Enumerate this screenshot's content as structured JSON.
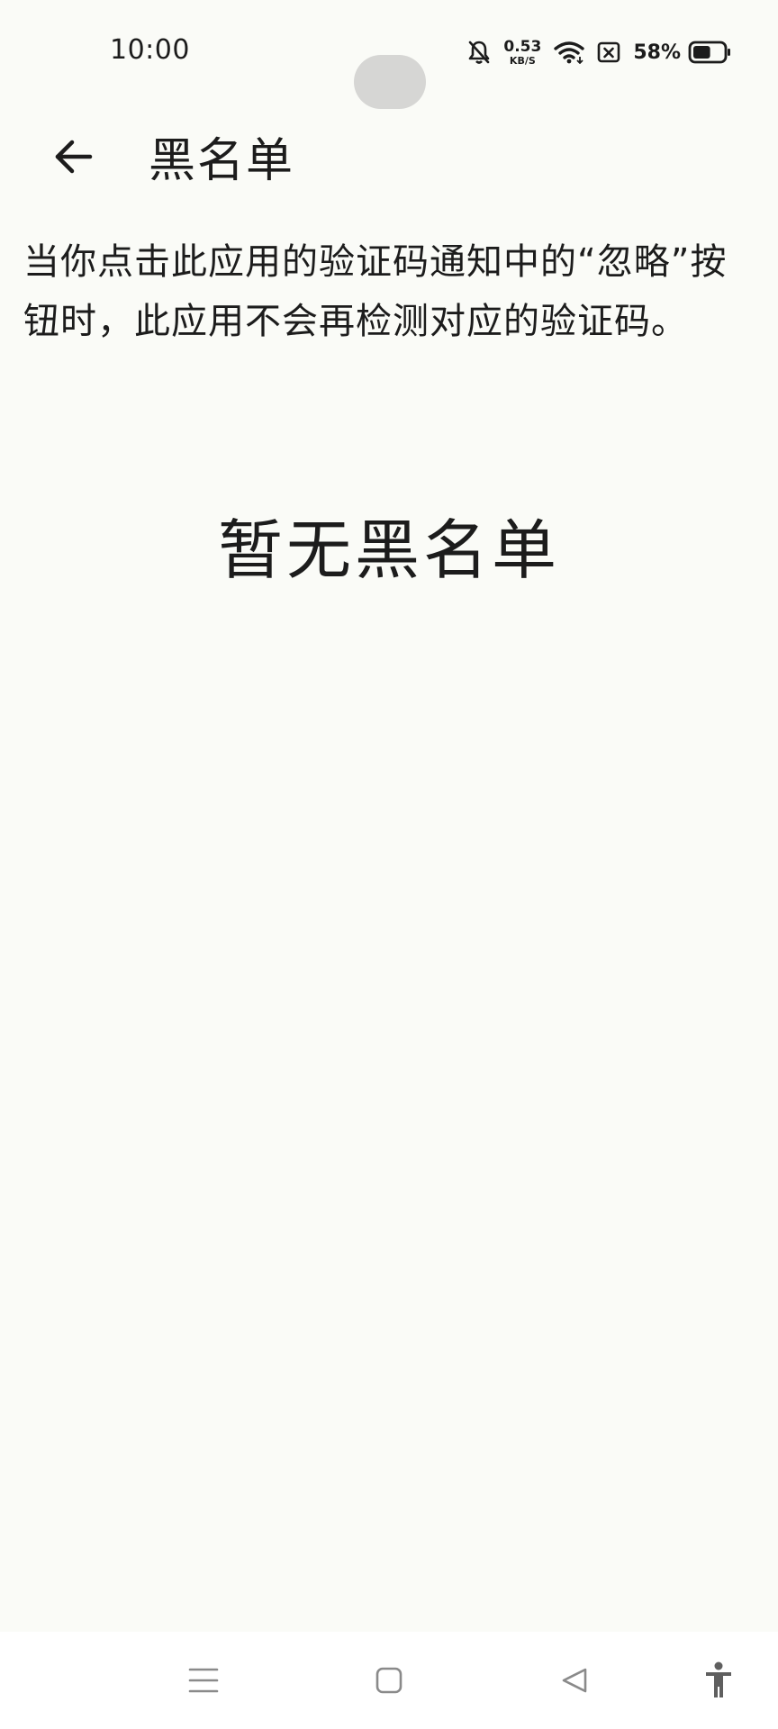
{
  "status_bar": {
    "time": "10:00",
    "net_speed_value": "0.53",
    "net_speed_unit": "KB/S",
    "battery_percent": "58%",
    "battery_level": 0.58,
    "icons": [
      "bell-off-icon",
      "wifi-icon",
      "sim-x-icon",
      "battery-icon"
    ]
  },
  "app_bar": {
    "back_icon": "arrow-left-icon",
    "title": "黑名单"
  },
  "content": {
    "description": "当你点击此应用的验证码通知中的“忽略”按钮时，此应用不会再检测对应的验证码。",
    "empty_message": "暂无黑名单"
  },
  "nav_bar": {
    "icons": [
      "menu-icon",
      "home-icon",
      "back-triangle-icon",
      "accessibility-icon"
    ]
  },
  "colors": {
    "background": "#fafbf7",
    "text": "#1c1c1c",
    "nav_background": "#ffffff",
    "nav_icon": "#8a8a8a"
  }
}
